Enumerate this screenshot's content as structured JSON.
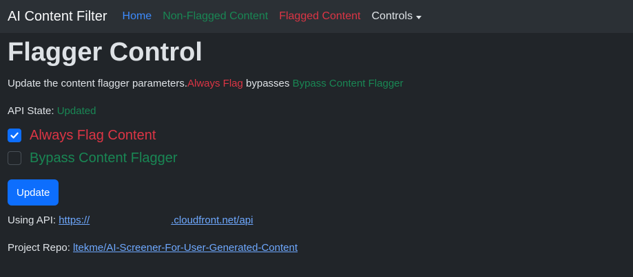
{
  "navbar": {
    "brand": "AI Content Filter",
    "links": [
      "Home",
      "Non-Flagged Content",
      "Flagged Content"
    ],
    "controls": "Controls"
  },
  "page": {
    "title": "Flagger Control",
    "desc_prefix": "Update the content flagger parameters.",
    "desc_always": "Always Flag",
    "desc_mid": " bypasses ",
    "desc_bypass": "Bypass Content Flagger",
    "api_state_label": "API State: ",
    "api_state_value": "Updated"
  },
  "options": [
    {
      "label": "Always Flag Content",
      "checked": true
    },
    {
      "label": "Bypass Content Flagger",
      "checked": false
    }
  ],
  "update_button": "Update",
  "api": {
    "label": "Using API: ",
    "url_prefix": "https://",
    "url_suffix": ".cloudfront.net/api"
  },
  "repo": {
    "label": "Project Repo: ",
    "link": "ltekme/AI-Screener-For-User-Generated-Content"
  },
  "colors": {
    "navbar_bg": "#2b3035",
    "page_bg": "#212529",
    "primary": "#0d6efd",
    "danger": "#dc3545",
    "success": "#198754",
    "link": "#6ea8fe"
  }
}
